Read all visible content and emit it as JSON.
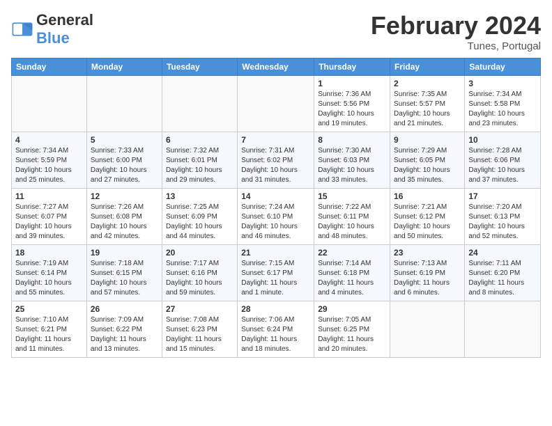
{
  "header": {
    "logo_general": "General",
    "logo_blue": "Blue",
    "month_title": "February 2024",
    "location": "Tunes, Portugal"
  },
  "days_of_week": [
    "Sunday",
    "Monday",
    "Tuesday",
    "Wednesday",
    "Thursday",
    "Friday",
    "Saturday"
  ],
  "weeks": [
    [
      {
        "day": "",
        "info": ""
      },
      {
        "day": "",
        "info": ""
      },
      {
        "day": "",
        "info": ""
      },
      {
        "day": "",
        "info": ""
      },
      {
        "day": "1",
        "info": "Sunrise: 7:36 AM\nSunset: 5:56 PM\nDaylight: 10 hours\nand 19 minutes."
      },
      {
        "day": "2",
        "info": "Sunrise: 7:35 AM\nSunset: 5:57 PM\nDaylight: 10 hours\nand 21 minutes."
      },
      {
        "day": "3",
        "info": "Sunrise: 7:34 AM\nSunset: 5:58 PM\nDaylight: 10 hours\nand 23 minutes."
      }
    ],
    [
      {
        "day": "4",
        "info": "Sunrise: 7:34 AM\nSunset: 5:59 PM\nDaylight: 10 hours\nand 25 minutes."
      },
      {
        "day": "5",
        "info": "Sunrise: 7:33 AM\nSunset: 6:00 PM\nDaylight: 10 hours\nand 27 minutes."
      },
      {
        "day": "6",
        "info": "Sunrise: 7:32 AM\nSunset: 6:01 PM\nDaylight: 10 hours\nand 29 minutes."
      },
      {
        "day": "7",
        "info": "Sunrise: 7:31 AM\nSunset: 6:02 PM\nDaylight: 10 hours\nand 31 minutes."
      },
      {
        "day": "8",
        "info": "Sunrise: 7:30 AM\nSunset: 6:03 PM\nDaylight: 10 hours\nand 33 minutes."
      },
      {
        "day": "9",
        "info": "Sunrise: 7:29 AM\nSunset: 6:05 PM\nDaylight: 10 hours\nand 35 minutes."
      },
      {
        "day": "10",
        "info": "Sunrise: 7:28 AM\nSunset: 6:06 PM\nDaylight: 10 hours\nand 37 minutes."
      }
    ],
    [
      {
        "day": "11",
        "info": "Sunrise: 7:27 AM\nSunset: 6:07 PM\nDaylight: 10 hours\nand 39 minutes."
      },
      {
        "day": "12",
        "info": "Sunrise: 7:26 AM\nSunset: 6:08 PM\nDaylight: 10 hours\nand 42 minutes."
      },
      {
        "day": "13",
        "info": "Sunrise: 7:25 AM\nSunset: 6:09 PM\nDaylight: 10 hours\nand 44 minutes."
      },
      {
        "day": "14",
        "info": "Sunrise: 7:24 AM\nSunset: 6:10 PM\nDaylight: 10 hours\nand 46 minutes."
      },
      {
        "day": "15",
        "info": "Sunrise: 7:22 AM\nSunset: 6:11 PM\nDaylight: 10 hours\nand 48 minutes."
      },
      {
        "day": "16",
        "info": "Sunrise: 7:21 AM\nSunset: 6:12 PM\nDaylight: 10 hours\nand 50 minutes."
      },
      {
        "day": "17",
        "info": "Sunrise: 7:20 AM\nSunset: 6:13 PM\nDaylight: 10 hours\nand 52 minutes."
      }
    ],
    [
      {
        "day": "18",
        "info": "Sunrise: 7:19 AM\nSunset: 6:14 PM\nDaylight: 10 hours\nand 55 minutes."
      },
      {
        "day": "19",
        "info": "Sunrise: 7:18 AM\nSunset: 6:15 PM\nDaylight: 10 hours\nand 57 minutes."
      },
      {
        "day": "20",
        "info": "Sunrise: 7:17 AM\nSunset: 6:16 PM\nDaylight: 10 hours\nand 59 minutes."
      },
      {
        "day": "21",
        "info": "Sunrise: 7:15 AM\nSunset: 6:17 PM\nDaylight: 11 hours\nand 1 minute."
      },
      {
        "day": "22",
        "info": "Sunrise: 7:14 AM\nSunset: 6:18 PM\nDaylight: 11 hours\nand 4 minutes."
      },
      {
        "day": "23",
        "info": "Sunrise: 7:13 AM\nSunset: 6:19 PM\nDaylight: 11 hours\nand 6 minutes."
      },
      {
        "day": "24",
        "info": "Sunrise: 7:11 AM\nSunset: 6:20 PM\nDaylight: 11 hours\nand 8 minutes."
      }
    ],
    [
      {
        "day": "25",
        "info": "Sunrise: 7:10 AM\nSunset: 6:21 PM\nDaylight: 11 hours\nand 11 minutes."
      },
      {
        "day": "26",
        "info": "Sunrise: 7:09 AM\nSunset: 6:22 PM\nDaylight: 11 hours\nand 13 minutes."
      },
      {
        "day": "27",
        "info": "Sunrise: 7:08 AM\nSunset: 6:23 PM\nDaylight: 11 hours\nand 15 minutes."
      },
      {
        "day": "28",
        "info": "Sunrise: 7:06 AM\nSunset: 6:24 PM\nDaylight: 11 hours\nand 18 minutes."
      },
      {
        "day": "29",
        "info": "Sunrise: 7:05 AM\nSunset: 6:25 PM\nDaylight: 11 hours\nand 20 minutes."
      },
      {
        "day": "",
        "info": ""
      },
      {
        "day": "",
        "info": ""
      }
    ]
  ]
}
